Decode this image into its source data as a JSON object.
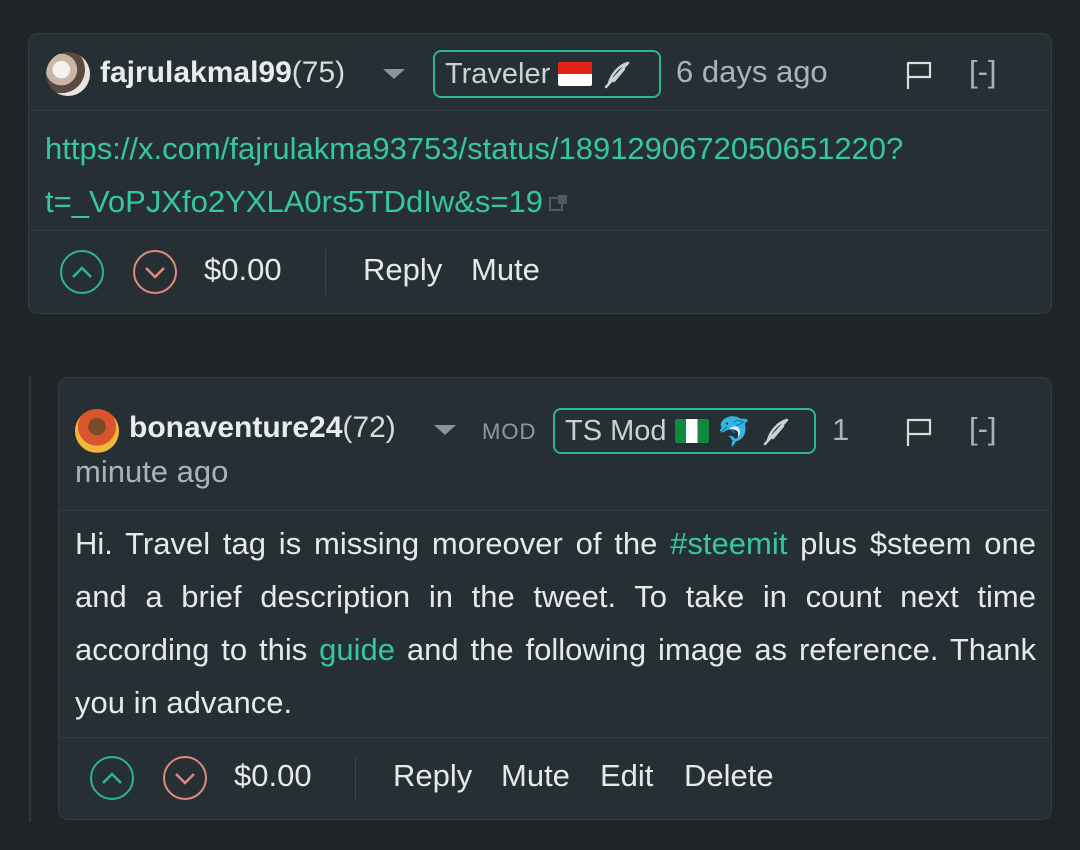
{
  "comments": [
    {
      "author": "fajrulakmal99",
      "reputation": "(75)",
      "badge": {
        "label": "Traveler",
        "flag": "Indonesia flag",
        "icon": "quill-icon"
      },
      "time": "6 days ago",
      "collapse": "[-]",
      "body": {
        "link_line1": "https://x.com/fajrulakma93753/status/1891290672050651220?",
        "link_line2": "t=_VoPJXfo2YXLA0rs5TDdIw&s=19"
      },
      "payout": "$0.00",
      "actions": [
        "Reply",
        "Mute"
      ]
    },
    {
      "author": "bonaventure24",
      "reputation": "(72)",
      "role": "MOD",
      "badge": {
        "label": "TS Mod",
        "flag": "Nigeria flag",
        "icon1": "dolphin-icon",
        "icon2": "quill-icon"
      },
      "time_part1": "1",
      "time_part2": "minute ago",
      "collapse": "[-]",
      "body": {
        "t1": "Hi. Travel tag is missing moreover of the ",
        "hashtag": "#steemit",
        "t2": " plus $steem one and a brief description in the tweet. To take in count next time according to this ",
        "guide_link": "guide",
        "t3": " and the following image as reference. Thank you in advance."
      },
      "payout": "$0.00",
      "actions": [
        "Reply",
        "Mute",
        "Edit",
        "Delete"
      ]
    }
  ],
  "colors": {
    "background": "#1e2428",
    "card": "#262f33",
    "accent": "#35c6a3",
    "downvote": "#e08a80"
  }
}
